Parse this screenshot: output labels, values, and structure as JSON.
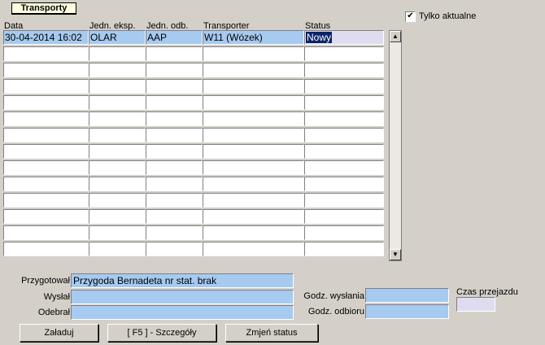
{
  "tab": {
    "label": "Transporty"
  },
  "filter": {
    "label": "Tylko aktualne",
    "checked": true,
    "mark": "✔"
  },
  "columns": [
    "Data",
    "Jedn. eksp.",
    "Jedn. odb.",
    "Transporter",
    "Status"
  ],
  "rows": [
    [
      "30-04-2014 16:02",
      "OLAR",
      "AAP",
      "W11 (Wózek)",
      "Nowy"
    ],
    [
      "",
      "",
      "",
      "",
      ""
    ],
    [
      "",
      "",
      "",
      "",
      ""
    ],
    [
      "",
      "",
      "",
      "",
      ""
    ],
    [
      "",
      "",
      "",
      "",
      ""
    ],
    [
      "",
      "",
      "",
      "",
      ""
    ],
    [
      "",
      "",
      "",
      "",
      ""
    ],
    [
      "",
      "",
      "",
      "",
      ""
    ],
    [
      "",
      "",
      "",
      "",
      ""
    ],
    [
      "",
      "",
      "",
      "",
      ""
    ],
    [
      "",
      "",
      "",
      "",
      ""
    ],
    [
      "",
      "",
      "",
      "",
      ""
    ],
    [
      "",
      "",
      "",
      "",
      ""
    ],
    [
      "",
      "",
      "",
      "",
      ""
    ]
  ],
  "scroll": {
    "up": "▲",
    "down": "▼"
  },
  "details": {
    "prepared_label": "Przygotował",
    "prepared_value": "Przygoda Bernadeta nr stat. brak",
    "sent_label": "Wysłał",
    "sent_value": "",
    "received_label": "Odebrał",
    "received_value": "",
    "send_time_label": "Godz. wysłania",
    "send_time_value": "",
    "receive_time_label": "Godz. odbioru",
    "receive_time_value": "",
    "travel_time_label": "Czas przejazdu",
    "travel_time_value": ""
  },
  "buttons": {
    "load": "Załaduj",
    "details": "[ F5 ] - Szczegóły",
    "change_status": "Zmjeń status"
  }
}
